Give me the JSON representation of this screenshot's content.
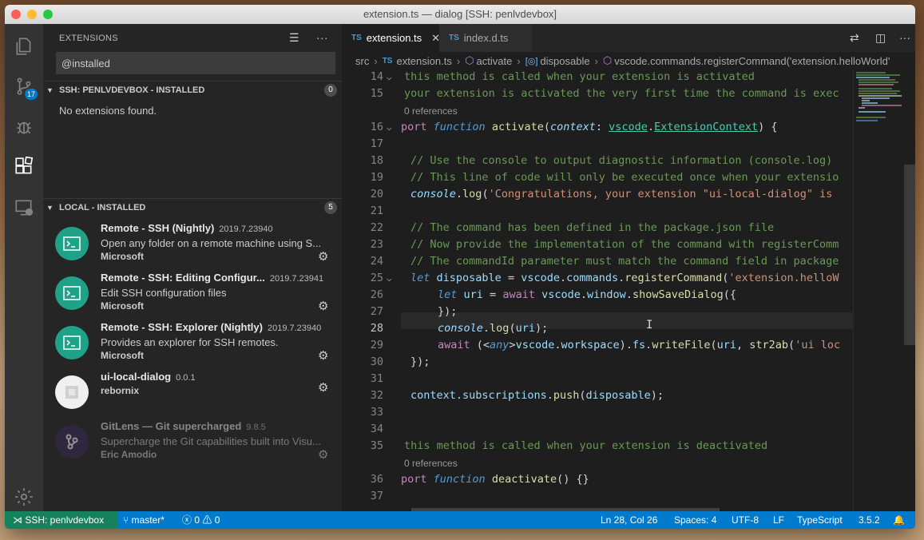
{
  "window": {
    "title": "extension.ts — dialog [SSH: penlvdevbox]"
  },
  "activity": {
    "scm_badge": "17"
  },
  "sidebar": {
    "title": "EXTENSIONS",
    "search_value": "@installed",
    "ssh_section": {
      "label": "SSH: PENLVDEVBOX - INSTALLED",
      "count": "0",
      "empty_text": "No extensions found."
    },
    "local_section": {
      "label": "LOCAL - INSTALLED",
      "count": "5"
    },
    "extensions": [
      {
        "name": "Remote - SSH (Nightly)",
        "version": "2019.7.23940",
        "description": "Open any folder on a remote machine using S...",
        "publisher": "Microsoft"
      },
      {
        "name": "Remote - SSH: Editing Configur...",
        "version": "2019.7.23941",
        "description": "Edit SSH configuration files",
        "publisher": "Microsoft"
      },
      {
        "name": "Remote - SSH: Explorer (Nightly)",
        "version": "2019.7.23940",
        "description": "Provides an explorer for SSH remotes.",
        "publisher": "Microsoft"
      },
      {
        "name": "ui-local-dialog",
        "version": "0.0.1",
        "description": "",
        "publisher": "rebornix"
      },
      {
        "name": "GitLens — Git supercharged",
        "version": "9.8.5",
        "description": "Supercharge the Git capabilities built into Visu...",
        "publisher": "Eric Amodio"
      }
    ]
  },
  "editor": {
    "tabs": [
      {
        "icon": "TS",
        "label": "extension.ts"
      },
      {
        "icon": "TS",
        "label": "index.d.ts"
      }
    ],
    "breadcrumbs": {
      "folder": "src",
      "file": "extension.ts",
      "fn": "activate",
      "var": "disposable",
      "call": "vscode.commands.registerCommand('extension.helloWorld'"
    },
    "references": "0 references",
    "line_numbers": [
      "14",
      "15",
      "16",
      "17",
      "18",
      "19",
      "20",
      "21",
      "22",
      "23",
      "24",
      "25",
      "26",
      "27",
      "28",
      "29",
      "30",
      "31",
      "32",
      "33",
      "34",
      "35",
      "36",
      "37"
    ]
  },
  "status": {
    "remote": "SSH: penlvdevbox",
    "branch": "master*",
    "errors": "0",
    "warnings": "0",
    "position": "Ln 28, Col 26",
    "spaces": "Spaces: 4",
    "encoding": "UTF-8",
    "eol": "LF",
    "language": "TypeScript",
    "version": "3.5.2"
  },
  "colors": {
    "status_bar": "#007acc",
    "remote_indicator": "#16825d",
    "extension_logo": "#1fa287"
  }
}
